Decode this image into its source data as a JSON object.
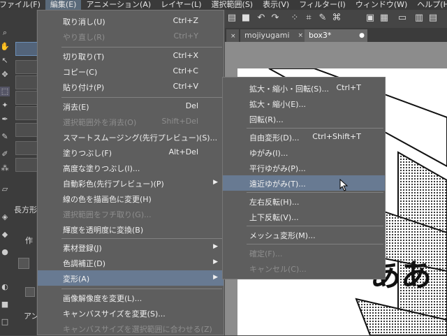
{
  "menubar": {
    "items": [
      {
        "label": "ファイル(F)"
      },
      {
        "label": "編集(E)"
      },
      {
        "label": "アニメーション(A)"
      },
      {
        "label": "レイヤー(L)"
      },
      {
        "label": "選択範囲(S)"
      },
      {
        "label": "表示(V)"
      },
      {
        "label": "フィルター(I)"
      },
      {
        "label": "ウィンドウ(W)"
      },
      {
        "label": "ヘルプ(H)"
      }
    ]
  },
  "tabs": [
    {
      "label": "mojiyugami"
    },
    {
      "label": "box3*"
    }
  ],
  "left_panel": {
    "subtool_label": "長方形",
    "label_2": "作",
    "label_3": "アン"
  },
  "edit_menu": {
    "items": [
      {
        "label": "取り消し(U)",
        "shortcut": "Ctrl+Z",
        "disabled": false
      },
      {
        "label": "やり直し(R)",
        "shortcut": "Ctrl+Y",
        "disabled": true
      },
      {
        "label": "切り取り(T)",
        "shortcut": "Ctrl+X",
        "disabled": false
      },
      {
        "label": "コピー(C)",
        "shortcut": "Ctrl+C",
        "disabled": false
      },
      {
        "label": "貼り付け(P)",
        "shortcut": "Ctrl+V",
        "disabled": false
      },
      {
        "label": "消去(E)",
        "shortcut": "Del",
        "disabled": false
      },
      {
        "label": "選択範囲外を消去(O)",
        "shortcut": "Shift+Del",
        "disabled": true
      },
      {
        "label": "スマートスムージング(先行プレビュー)(S)...",
        "shortcut": "",
        "disabled": false
      },
      {
        "label": "塗りつぶし(F)",
        "shortcut": "Alt+Del",
        "disabled": false
      },
      {
        "label": "高度な塗りつぶし(I)...",
        "shortcut": "",
        "disabled": false
      },
      {
        "label": "自動彩色(先行プレビュー)(P)",
        "shortcut": "",
        "disabled": false
      },
      {
        "label": "線の色を描画色に変更(H)",
        "shortcut": "",
        "disabled": false
      },
      {
        "label": "選択範囲をフチ取り(G)...",
        "shortcut": "",
        "disabled": true
      },
      {
        "label": "輝度を透明度に変換(B)",
        "shortcut": "",
        "disabled": false
      },
      {
        "label": "素材登録(J)",
        "shortcut": "",
        "disabled": false
      },
      {
        "label": "色調補正(D)",
        "shortcut": "",
        "disabled": false
      },
      {
        "label": "変形(A)",
        "shortcut": "",
        "disabled": false
      },
      {
        "label": "画像解像度を変更(L)...",
        "shortcut": "",
        "disabled": false
      },
      {
        "label": "キャンバスサイズを変更(S)...",
        "shortcut": "",
        "disabled": false
      },
      {
        "label": "キャンバスサイズを選択範囲に合わせる(Z)",
        "shortcut": "",
        "disabled": true
      }
    ]
  },
  "transform_submenu": {
    "items": [
      {
        "label": "拡大・縮小・回転(S)...",
        "shortcut": "Ctrl+T",
        "disabled": false
      },
      {
        "label": "拡大・縮小(E)...",
        "shortcut": "",
        "disabled": false
      },
      {
        "label": "回転(R)...",
        "shortcut": "",
        "disabled": false
      },
      {
        "label": "自由変形(D)...",
        "shortcut": "Ctrl+Shift+T",
        "disabled": false
      },
      {
        "label": "ゆがみ(I)...",
        "shortcut": "",
        "disabled": false
      },
      {
        "label": "平行ゆがみ(P)...",
        "shortcut": "",
        "disabled": false
      },
      {
        "label": "遠近ゆがみ(T)...",
        "shortcut": "",
        "disabled": false
      },
      {
        "label": "左右反転(H)...",
        "shortcut": "",
        "disabled": false
      },
      {
        "label": "上下反転(V)...",
        "shortcut": "",
        "disabled": false
      },
      {
        "label": "メッシュ変形(M)...",
        "shortcut": "",
        "disabled": false
      },
      {
        "label": "確定(F)...",
        "shortcut": "",
        "disabled": true
      },
      {
        "label": "キャンセル(C)...",
        "shortcut": "",
        "disabled": true
      }
    ]
  },
  "canvas": {
    "text": "ああ"
  },
  "colors": {
    "highlight": "#687a92",
    "menu_bg": "#5e5e5e",
    "disabled_text": "#8e8e8e"
  }
}
